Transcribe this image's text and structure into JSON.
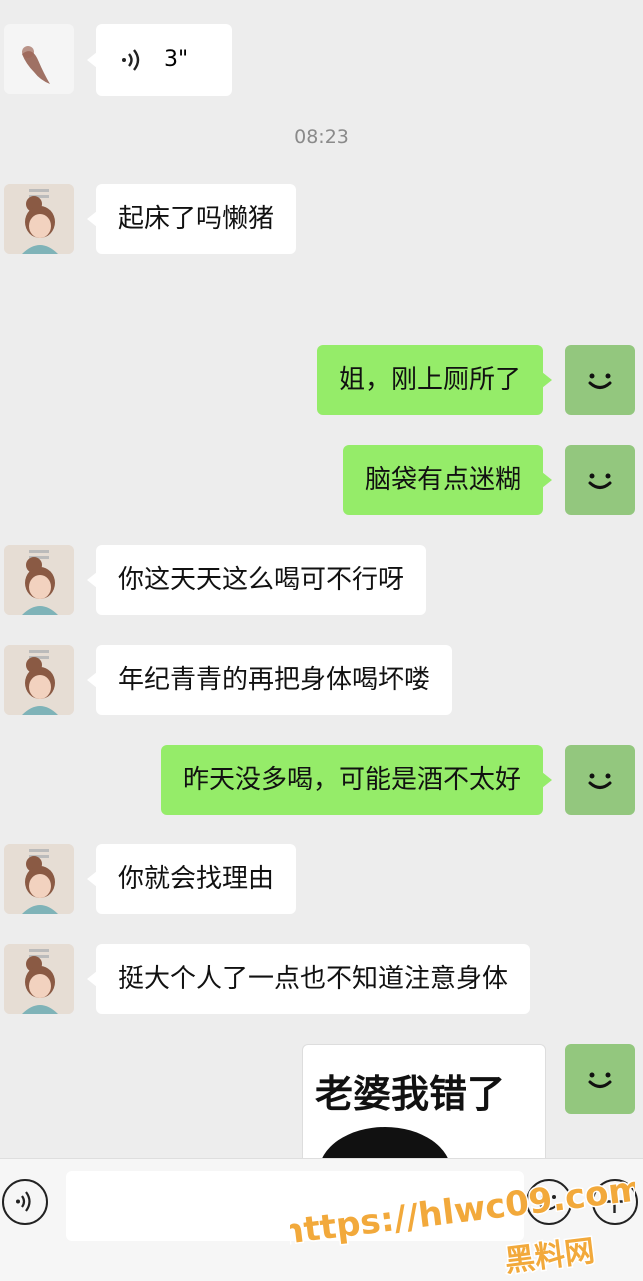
{
  "voice_message": {
    "duration": "3\"",
    "icon": "voice-wave-icon"
  },
  "timestamp": "08:23",
  "messages": [
    {
      "side": "in",
      "text": "起床了吗懒猪"
    },
    {
      "side": "out",
      "text": "姐，刚上厕所了"
    },
    {
      "side": "out",
      "text": "脑袋有点迷糊"
    },
    {
      "side": "in",
      "text": "你这天天这么喝可不行呀"
    },
    {
      "side": "in",
      "text": "年纪青青的再把身体喝坏喽"
    },
    {
      "side": "out",
      "text": "昨天没多喝，可能是酒不太好"
    },
    {
      "side": "in",
      "text": "你就会找理由"
    },
    {
      "side": "in",
      "text": "挺大个人了一点也不知道注意身体"
    }
  ],
  "sticker": {
    "text": "老婆我错了"
  },
  "input_bar": {
    "voice_button_icon": "voice-input-icon",
    "emoji_button_icon": "emoji-icon",
    "plus_button_icon": "plus-icon"
  },
  "watermark": {
    "url": "https://hlwc09.com",
    "name": "黑料网"
  },
  "colors": {
    "background": "#ededed",
    "outgoing_bubble": "#95ec69",
    "incoming_bubble": "#ffffff",
    "my_avatar": "#93c77e",
    "watermark": "#f2a93b"
  }
}
